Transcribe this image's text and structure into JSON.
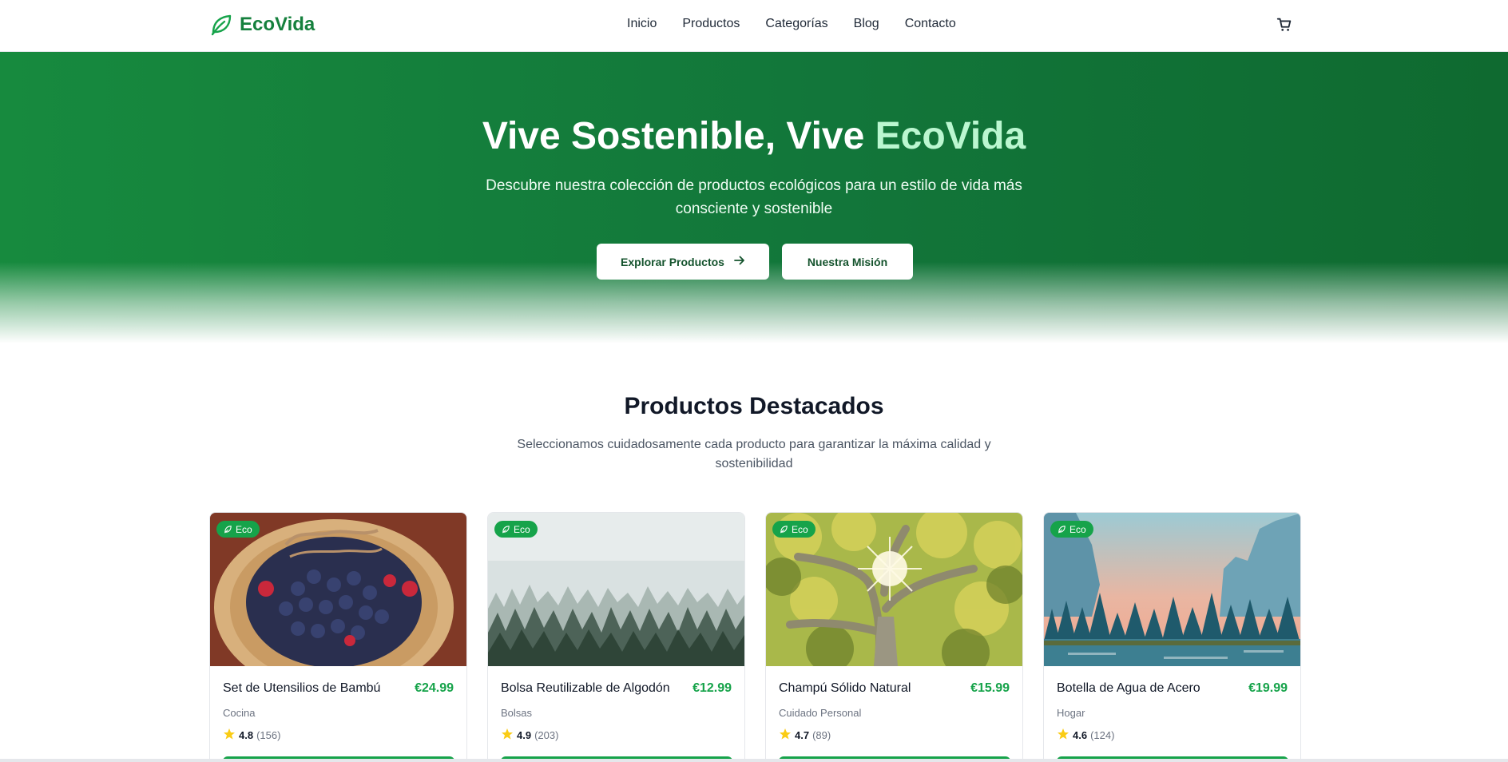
{
  "brand": {
    "name": "EcoVida",
    "icon": "leaf-icon",
    "color": "#15803d"
  },
  "nav": {
    "items": [
      {
        "label": "Inicio"
      },
      {
        "label": "Productos"
      },
      {
        "label": "Categorías"
      },
      {
        "label": "Blog"
      },
      {
        "label": "Contacto"
      }
    ],
    "cart_icon": "shopping-cart-icon"
  },
  "hero": {
    "title_prefix": "Vive Sostenible, Vive",
    "title_accent": "EcoVida",
    "subtitle": "Descubre nuestra colección de productos ecológicos para un estilo de vida más consciente y sostenible",
    "primary_button": "Explorar Productos",
    "secondary_button": "Nuestra Misión",
    "primary_icon": "arrow-right-icon",
    "accent_color": "#bbf7d0",
    "bg_color": "#15803d"
  },
  "featured": {
    "title": "Productos Destacados",
    "subtitle": "Seleccionamos cuidadosamente cada producto para garantizar la máxima calidad y sostenibilidad",
    "badge_label": "Eco",
    "products": [
      {
        "name": "Set de Utensilios de Bambú",
        "price": "€24.99",
        "category": "Cocina",
        "rating": "4.8",
        "reviews": "(156)"
      },
      {
        "name": "Bolsa Reutilizable de Algodón",
        "price": "€12.99",
        "category": "Bolsas",
        "rating": "4.9",
        "reviews": "(203)"
      },
      {
        "name": "Champú Sólido Natural",
        "price": "€15.99",
        "category": "Cuidado Personal",
        "rating": "4.7",
        "reviews": "(89)"
      },
      {
        "name": "Botella de Agua de Acero",
        "price": "€19.99",
        "category": "Hogar",
        "rating": "4.6",
        "reviews": "(124)"
      }
    ]
  }
}
